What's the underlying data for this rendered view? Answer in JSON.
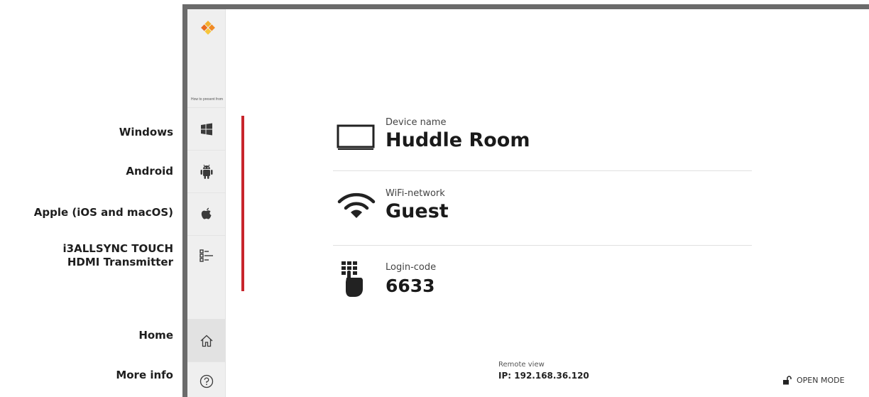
{
  "callouts": {
    "windows": "Windows",
    "android": "Android",
    "apple": "Apple (iOS and macOS)",
    "transmitter_line1": "i3ALLSYNC TOUCH",
    "transmitter_line2": "HDMI Transmitter",
    "home": "Home",
    "more_info": "More info"
  },
  "sidebar": {
    "how_to_label": "How to present from",
    "items": [
      {
        "icon": "windows-icon"
      },
      {
        "icon": "android-icon"
      },
      {
        "icon": "apple-icon"
      },
      {
        "icon": "transmitter-icon"
      },
      {
        "icon": "home-icon"
      },
      {
        "icon": "help-icon"
      }
    ]
  },
  "device": {
    "label": "Device name",
    "value": "Huddle Room",
    "icon": "monitor-icon"
  },
  "wifi": {
    "label": "WiFi-network",
    "value": "Guest",
    "icon": "wifi-icon"
  },
  "login": {
    "label": "Login-code",
    "value": "6633",
    "icon": "keypad-hand-icon"
  },
  "remote": {
    "label": "Remote view",
    "ip_prefix": "IP:",
    "ip": "192.168.36.120"
  },
  "mode": {
    "label": "OPEN MODE",
    "icon": "unlocked-icon"
  },
  "colors": {
    "accent": "#c8252c",
    "frame": "#6b6b6b",
    "sidebar_bg": "#efefef",
    "logo": "#f0a22b"
  }
}
